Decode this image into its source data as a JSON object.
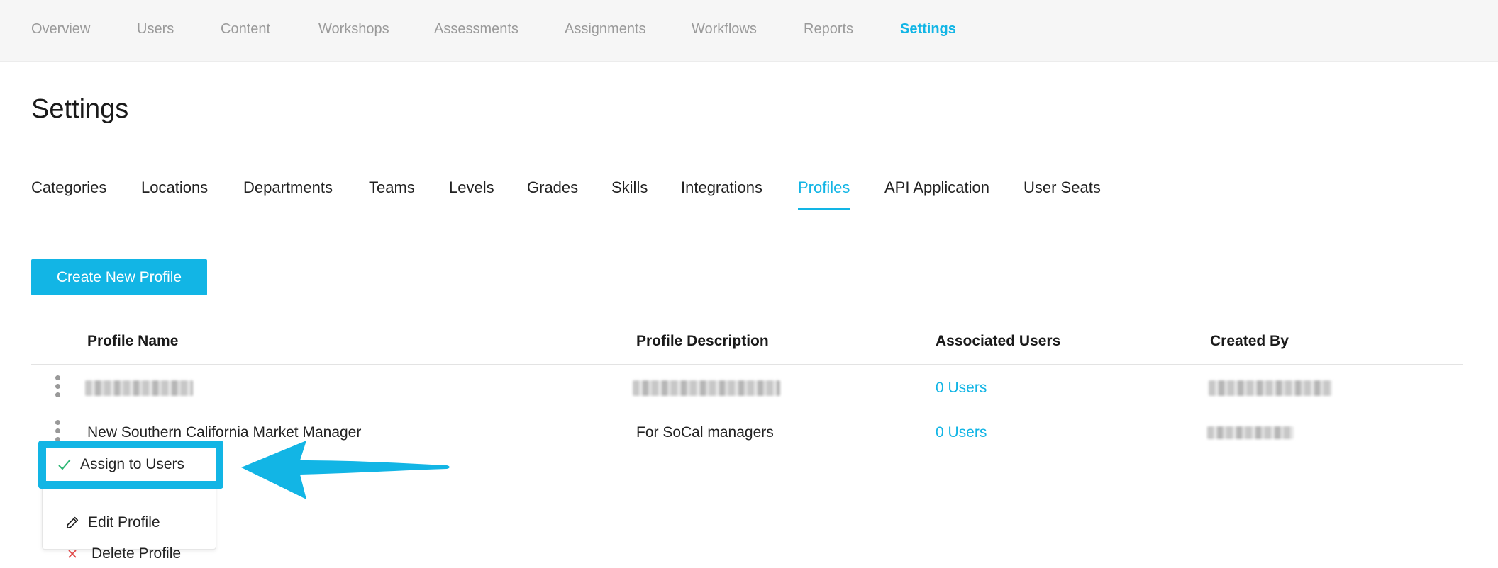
{
  "topnav": {
    "items": [
      {
        "label": "Overview"
      },
      {
        "label": "Users"
      },
      {
        "label": "Content"
      },
      {
        "label": "Workshops"
      },
      {
        "label": "Assessments"
      },
      {
        "label": "Assignments"
      },
      {
        "label": "Workflows"
      },
      {
        "label": "Reports"
      },
      {
        "label": "Settings",
        "active": true
      }
    ]
  },
  "page": {
    "title": "Settings"
  },
  "tabs": [
    {
      "label": "Categories"
    },
    {
      "label": "Locations"
    },
    {
      "label": "Departments"
    },
    {
      "label": "Teams"
    },
    {
      "label": "Levels"
    },
    {
      "label": "Grades"
    },
    {
      "label": "Skills"
    },
    {
      "label": "Integrations"
    },
    {
      "label": "Profiles",
      "active": true
    },
    {
      "label": "API Application"
    },
    {
      "label": "User Seats"
    }
  ],
  "actions": {
    "create_label": "Create New Profile"
  },
  "table": {
    "headers": {
      "name": "Profile Name",
      "description": "Profile Description",
      "users": "Associated Users",
      "created_by": "Created By"
    },
    "rows": [
      {
        "name": "",
        "description": "",
        "users": "0 Users",
        "created_by": ""
      },
      {
        "name": "New Southern California Market Manager",
        "description": "For SoCal managers",
        "users": "0 Users",
        "created_by": ""
      }
    ]
  },
  "row_menu": {
    "items": [
      {
        "label": "Assign to Users",
        "icon": "check-icon"
      },
      {
        "label": "Edit Profile",
        "icon": "pencil-icon"
      },
      {
        "label": "Delete Profile",
        "icon": "close-icon"
      }
    ]
  },
  "colors": {
    "accent": "#12b5e5",
    "check": "#2bb673",
    "delete": "#e04848"
  }
}
